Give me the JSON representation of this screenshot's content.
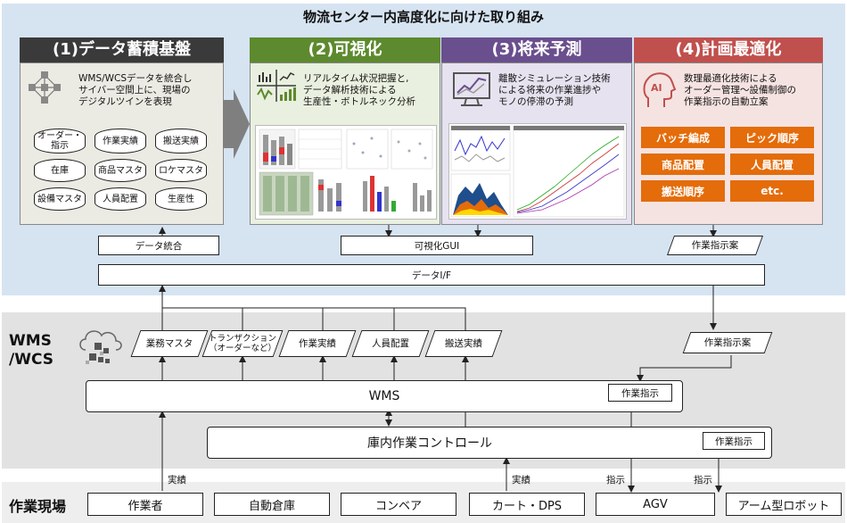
{
  "title": "物流センター内高度化に向けた取り組み",
  "panels": {
    "p1": {
      "title": "(1)データ蓄積基盤",
      "desc": [
        "WMS/WCSデータを統合し",
        "サイバー空間上に、現場の",
        "デジタルツインを表現"
      ],
      "dbs": [
        "オーダー・指示",
        "作業実績",
        "搬送実績",
        "在庫",
        "商品マスタ",
        "ロケマスタ",
        "設備マスタ",
        "人員配置",
        "生産性"
      ],
      "color": "#3a3a3a"
    },
    "p2": {
      "title": "(2)可視化",
      "desc": [
        "リアルタイム状況把握と,",
        "データ解析技術による",
        "生産性・ボトルネック分析"
      ],
      "color": "#5d8a2e"
    },
    "p3": {
      "title": "(3)将来予測",
      "desc": [
        "離散シミュレーション技術",
        "による将来の作業進捗や",
        "モノの停滞の予測"
      ],
      "color": "#6a4f8e"
    },
    "p4": {
      "title": "(4)計画最適化",
      "desc": [
        "数理最適化技術による",
        "オーダー管理～設備制御の",
        "作業指示の自動立案"
      ],
      "items": [
        "バッチ編成",
        "ピック順序",
        "商品配置",
        "人員配置",
        "搬送順序",
        "etc."
      ],
      "color": "#c0504d"
    }
  },
  "labels": {
    "data_integration": "データ統合",
    "visualization_gui": "可視化GUI",
    "work_plan_top": "作業指示案",
    "data_if": "データI/F",
    "work_plan_mid": "作業指示案",
    "wms": "WMS",
    "wms_instruction": "作業指示",
    "control": "庫内作業コントロール",
    "control_instruction": "作業指示",
    "side_wms": [
      "WMS",
      "/WCS"
    ],
    "bottom_label": "作業現場",
    "jisseki1": "実績",
    "jisseki2": "実績",
    "shiji1": "指示",
    "shiji2": "指示"
  },
  "data_items": [
    "業務マスタ",
    "トランザクション（オーダーなど）",
    "作業実績",
    "人員配置",
    "搬送実績"
  ],
  "field_items": [
    "作業者",
    "自動倉庫",
    "コンベア",
    "カート・DPS",
    "AGV",
    "アーム型ロボット"
  ]
}
